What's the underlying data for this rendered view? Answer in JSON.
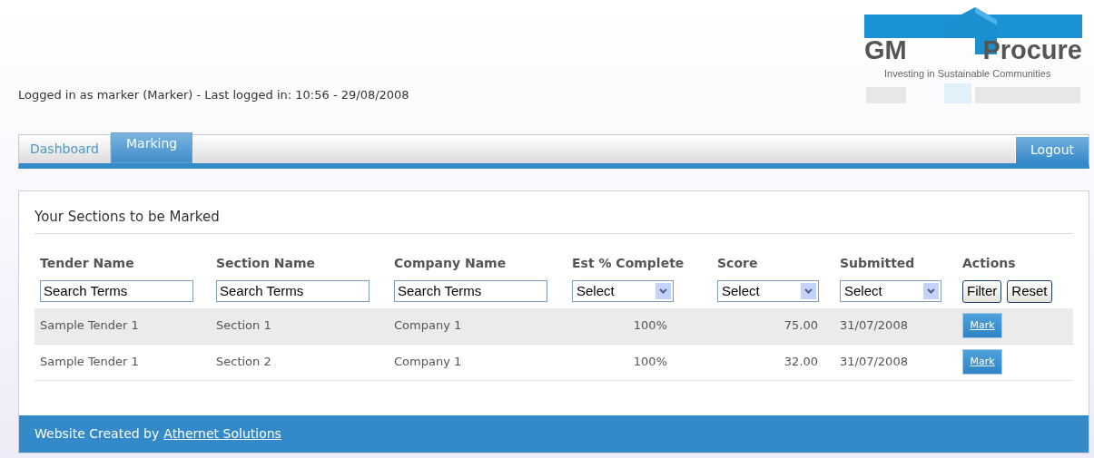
{
  "logo": {
    "left_word": "GM",
    "right_word": "Procure",
    "tagline": "Investing in Sustainable Communities"
  },
  "login_info": "Logged in as marker (Marker) - Last logged in: 10:56 - 29/08/2008",
  "tabs": [
    {
      "label": "Dashboard",
      "selected": false
    },
    {
      "label": "Marking",
      "selected": true
    }
  ],
  "logout": "Logout",
  "panel": {
    "title": "Your Sections to be Marked",
    "columns": [
      {
        "label": "Tender Name",
        "filter": {
          "kind": "text",
          "value": "Search Terms"
        }
      },
      {
        "label": "Section Name",
        "filter": {
          "kind": "text",
          "value": "Search Terms"
        }
      },
      {
        "label": "Company Name",
        "filter": {
          "kind": "text",
          "value": "Search Terms"
        }
      },
      {
        "label": "Est % Complete",
        "filter": {
          "kind": "select",
          "value": "Select"
        }
      },
      {
        "label": "Score",
        "filter": {
          "kind": "select",
          "value": "Select"
        }
      },
      {
        "label": "Submitted",
        "filter": {
          "kind": "select",
          "value": "Select"
        }
      },
      {
        "label": "Actions",
        "filter": {
          "kind": "buttons",
          "buttons": [
            "Filter",
            "Reset"
          ]
        }
      }
    ],
    "rows": [
      {
        "tender": "Sample Tender 1",
        "section": "Section 1",
        "company": "Company 1",
        "complete": "100%",
        "score": "75.00",
        "submitted": "31/07/2008",
        "action": "Mark"
      },
      {
        "tender": "Sample Tender 1",
        "section": "Section 2",
        "company": "Company 1",
        "complete": "100%",
        "score": "32.00",
        "submitted": "31/07/2008",
        "action": "Mark"
      }
    ]
  },
  "footer": {
    "text": "Website Created by",
    "link": "Athernet Solutions"
  }
}
